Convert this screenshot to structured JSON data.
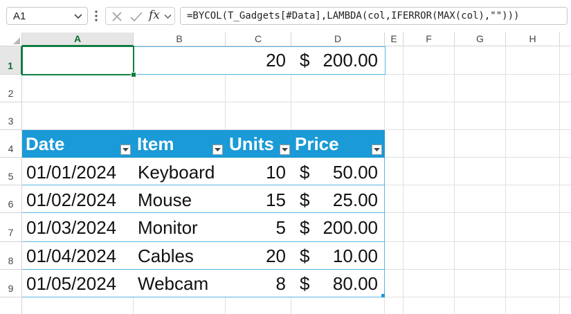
{
  "namebox": {
    "value": "A1"
  },
  "formula_bar": {
    "formula": "=BYCOL(T_Gadgets[#Data],LAMBDA(col,IFERROR(MAX(col),\"\")))",
    "fx_label": "fx"
  },
  "columns": [
    "A",
    "B",
    "C",
    "D",
    "E",
    "F",
    "G",
    "H"
  ],
  "rows": [
    "1",
    "2",
    "3",
    "4",
    "5",
    "6",
    "7",
    "8",
    "9"
  ],
  "row1": {
    "c": "20",
    "d_symbol": "$",
    "d_amount": "200.00"
  },
  "table": {
    "headers": [
      "Date",
      "Item",
      "Units",
      "Price"
    ],
    "rows": [
      {
        "date": "01/01/2024",
        "item": "Keyboard",
        "units": "10",
        "symbol": "$",
        "amount": "50.00"
      },
      {
        "date": "01/02/2024",
        "item": "Mouse",
        "units": "15",
        "symbol": "$",
        "amount": "25.00"
      },
      {
        "date": "01/03/2024",
        "item": "Monitor",
        "units": "5",
        "symbol": "$",
        "amount": "200.00"
      },
      {
        "date": "01/04/2024",
        "item": "Cables",
        "units": "20",
        "symbol": "$",
        "amount": "10.00"
      },
      {
        "date": "01/05/2024",
        "item": "Webcam",
        "units": "8",
        "symbol": "$",
        "amount": "80.00"
      }
    ]
  },
  "colors": {
    "table_header": "#1a9ad6",
    "selection": "#107c41",
    "table_border": "#5ab4e3"
  }
}
